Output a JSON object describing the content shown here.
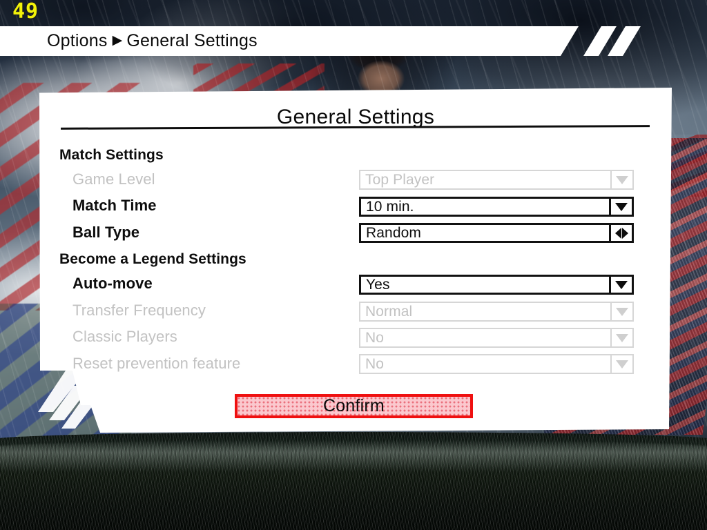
{
  "hud": {
    "fps": "49"
  },
  "header": {
    "crumb_root": "Options",
    "separator": "▶",
    "crumb_current": "General Settings"
  },
  "panel": {
    "title": "General Settings",
    "sections": [
      {
        "header": "Match Settings",
        "rows": [
          {
            "label": "Game Level",
            "value": "Top Player",
            "control": "dropdown",
            "disabled": true
          },
          {
            "label": "Match Time",
            "value": "10 min.",
            "control": "dropdown",
            "disabled": false
          },
          {
            "label": "Ball Type",
            "value": "Random",
            "control": "spinner",
            "disabled": false
          }
        ]
      },
      {
        "header": "Become a Legend Settings",
        "rows": [
          {
            "label": "Auto-move",
            "value": "Yes",
            "control": "dropdown",
            "disabled": false
          },
          {
            "label": "Transfer Frequency",
            "value": "Normal",
            "control": "dropdown",
            "disabled": true
          },
          {
            "label": "Classic Players",
            "value": "No",
            "control": "dropdown",
            "disabled": true
          },
          {
            "label": "Reset prevention feature",
            "value": "No",
            "control": "dropdown",
            "disabled": true
          }
        ]
      }
    ],
    "confirm_label": "Confirm"
  },
  "icons": {
    "dropdown_arrow": "chevron-down-icon",
    "spinner_arrows": "left-right-arrows-icon"
  },
  "colors": {
    "confirm_border": "#ef1010",
    "confirm_fill": "#fbc8ce",
    "fps_text": "#f2f20a",
    "panel_bg": "#ffffff",
    "text": "#0d0d0d",
    "disabled_text": "#c2c2c2"
  }
}
